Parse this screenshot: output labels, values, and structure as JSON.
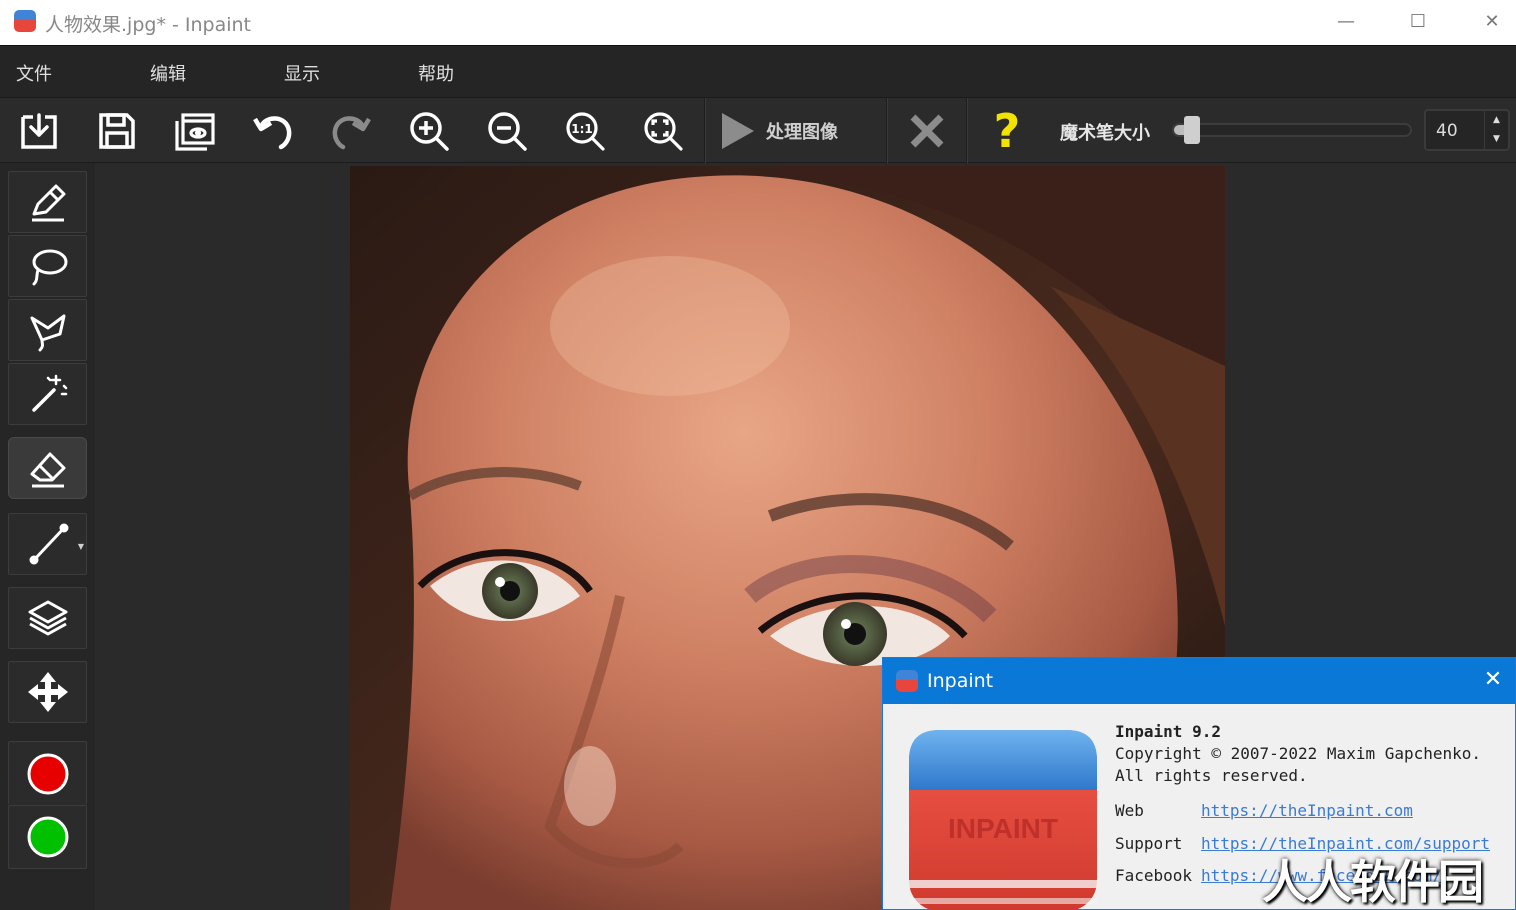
{
  "window": {
    "title": "人物效果.jpg* - Inpaint",
    "minimize": "—",
    "maximize": "☐",
    "close": "✕"
  },
  "menu": {
    "items": [
      {
        "label": "文件"
      },
      {
        "label": "编辑"
      },
      {
        "label": "显示"
      },
      {
        "label": "帮助"
      }
    ]
  },
  "toolbar": {
    "process_label": "处理图像",
    "zoom_1to1_label": "1:1",
    "help_glyph": "?",
    "brush_size_label": "魔术笔大小",
    "brush_size_value": "40",
    "brush_size_fraction": 0.05,
    "spin_up": "▲",
    "spin_down": "▼"
  },
  "colors": {
    "accent_blue": "#0a78d7",
    "help_yellow": "#f2e400",
    "marker_red": "#e60000",
    "marker_green": "#00c000"
  },
  "tools": [
    {
      "icon": "marker-pen-icon"
    },
    {
      "icon": "lasso-icon"
    },
    {
      "icon": "polygonal-lasso-icon"
    },
    {
      "icon": "magic-wand-icon"
    },
    {
      "icon": "eraser-icon",
      "active": true
    },
    {
      "icon": "guide-line-icon"
    },
    {
      "icon": "layers-icon"
    },
    {
      "icon": "move-icon"
    },
    {
      "icon": "red-marker-color-icon"
    },
    {
      "icon": "green-marker-color-icon"
    }
  ],
  "about_dialog": {
    "title": "Inpaint",
    "close": "✕",
    "logo_text": "INPAINT",
    "product": "Inpaint 9.2",
    "copyright": "Copyright © 2007-2022 Maxim Gapchenko.",
    "rights": "All rights reserved.",
    "web_label": "Web",
    "web_url": "https://theInpaint.com",
    "support_label": "Support",
    "support_url": "https://theInpaint.com/support",
    "facebook_label": "Facebook",
    "facebook_url": "https://www.facebook.com/"
  },
  "watermark": "人人软件园"
}
